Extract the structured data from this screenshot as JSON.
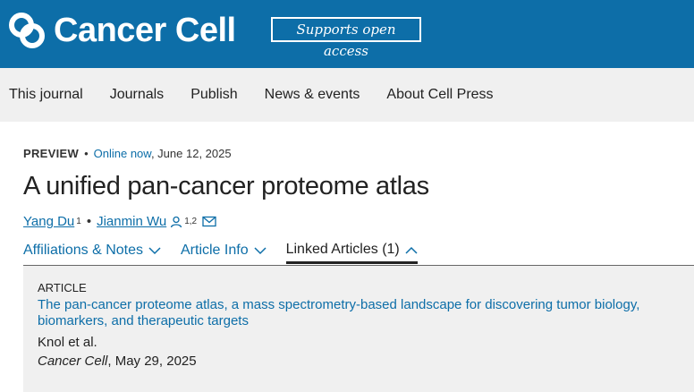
{
  "header": {
    "brand": "Cancer Cell",
    "oa_badge": "Supports open access",
    "logo_icon": "cell-press-logo-icon",
    "color": "#0d6ea8"
  },
  "nav": {
    "items": [
      "This journal",
      "Journals",
      "Publish",
      "News & events",
      "About Cell Press"
    ]
  },
  "article": {
    "type_label": "PREVIEW",
    "online_label": "Online now",
    "date": ", June 12, 2025",
    "title": "A unified pan-cancer proteome atlas",
    "authors": [
      {
        "name": "Yang Du",
        "sup": "1"
      },
      {
        "name": "Jianmin Wu",
        "sup": "1,2",
        "icons": [
          "person-icon",
          "email-icon"
        ]
      }
    ]
  },
  "tabs": [
    {
      "label": "Affiliations & Notes",
      "icon": "chevron-down-icon"
    },
    {
      "label": "Article Info",
      "icon": "chevron-down-icon"
    },
    {
      "label": "Linked Articles (1)",
      "icon": "chevron-up-icon",
      "active": true
    }
  ],
  "linked": {
    "label": "ARTICLE",
    "title": "The pan-cancer proteome atlas, a mass spectrometry-based landscape for discovering tumor biology, biomarkers, and therapeutic targets",
    "authors": "Knol et al.",
    "journal": "Cancer Cell",
    "date": ", May 29, 2025"
  }
}
